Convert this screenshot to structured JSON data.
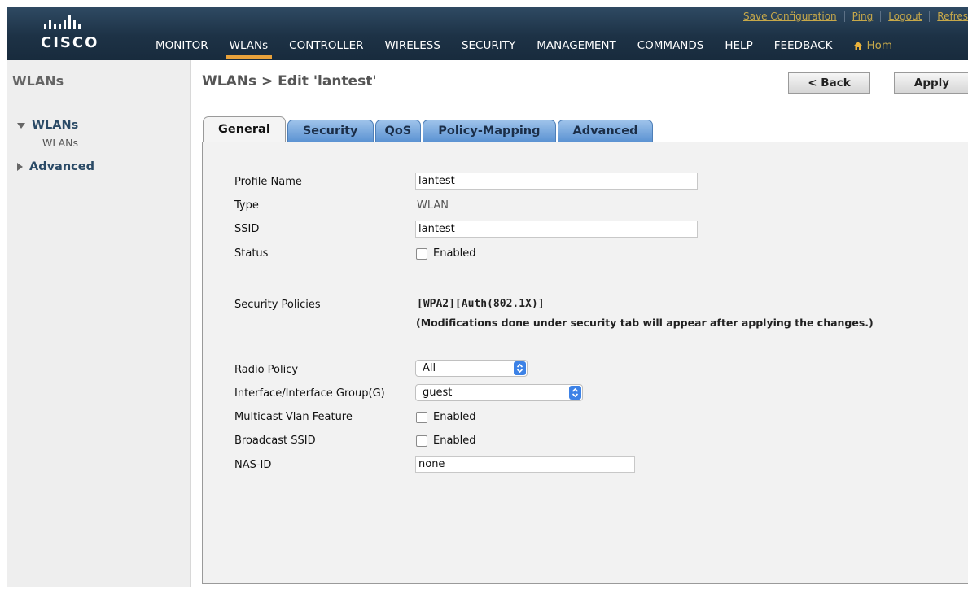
{
  "header": {
    "brand": "CISCO",
    "utility_links": [
      "Save Configuration",
      "Ping",
      "Logout",
      "Refres"
    ],
    "nav": [
      "MONITOR",
      "WLANs",
      "CONTROLLER",
      "WIRELESS",
      "SECURITY",
      "MANAGEMENT",
      "COMMANDS",
      "HELP",
      "FEEDBACK"
    ],
    "active_nav": "WLANs",
    "home_label": "Hom"
  },
  "sidebar": {
    "title": "WLANs",
    "wlans_label": "WLANs",
    "wlans_sub": "WLANs",
    "advanced_label": "Advanced"
  },
  "page": {
    "title": "WLANs > Edit  'lantest'",
    "back_label": "< Back",
    "apply_label": "Apply"
  },
  "tabs": [
    "General",
    "Security",
    "QoS",
    "Policy-Mapping",
    "Advanced"
  ],
  "active_tab": "General",
  "form": {
    "profile_name_label": "Profile Name",
    "profile_name_value": "lantest",
    "type_label": "Type",
    "type_value": "WLAN",
    "ssid_label": "SSID",
    "ssid_value": "lantest",
    "status_label": "Status",
    "status_checkbox": "Enabled",
    "security_policies_label": "Security Policies",
    "security_policies_value": "[WPA2][Auth(802.1X)]",
    "security_note": "(Modifications done under security tab will appear after applying the changes.)",
    "radio_policy_label": "Radio Policy",
    "radio_policy_value": "All",
    "interface_label": "Interface/Interface Group(G)",
    "interface_value": "guest",
    "multicast_label": "Multicast Vlan Feature",
    "multicast_checkbox": "Enabled",
    "broadcast_label": "Broadcast SSID",
    "broadcast_checkbox": "Enabled",
    "nas_id_label": "NAS-ID",
    "nas_id_value": "none"
  },
  "colors": {
    "header_bg": "#1d3246",
    "active_nav_underline": "#e9a23b",
    "utility_link": "#c6a84a",
    "tab_blue": "#5c93d3",
    "select_arrow": "#3d82e6"
  }
}
